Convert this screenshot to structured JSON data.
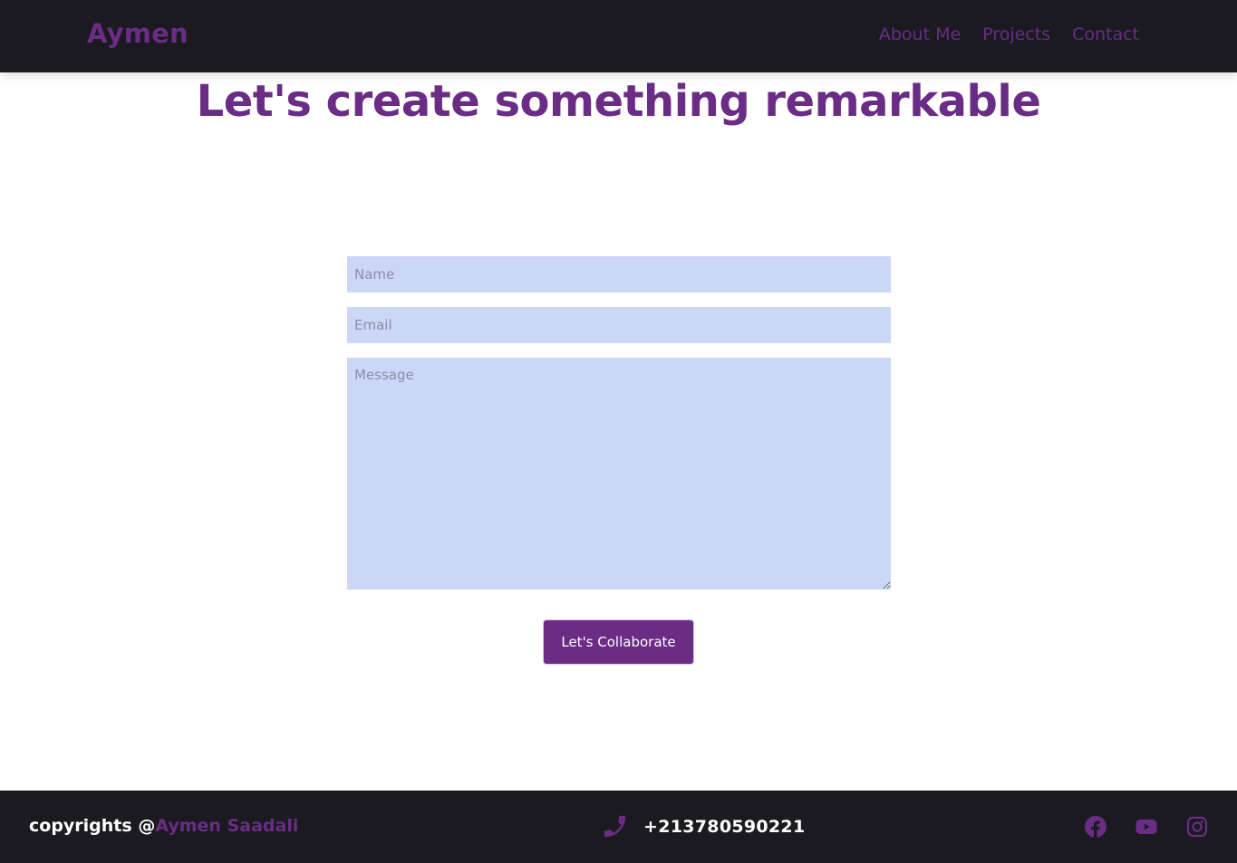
{
  "header": {
    "logo": "Aymen",
    "nav": [
      {
        "label": "About Me"
      },
      {
        "label": "Projects"
      },
      {
        "label": "Contact"
      }
    ]
  },
  "hero": {
    "title": "Let's create something remarkable"
  },
  "form": {
    "name_placeholder": "Name",
    "email_placeholder": "Email",
    "message_placeholder": "Message",
    "submit_label": "Let's Collaborate"
  },
  "footer": {
    "copyright_prefix": "copyrights @",
    "copyright_name": "Aymen Saadali",
    "phone": "+213780590221",
    "socials": [
      {
        "icon": "facebook-icon"
      },
      {
        "icon": "youtube-icon"
      },
      {
        "icon": "instagram-icon"
      }
    ]
  },
  "colors": {
    "brand": "#6a2c85",
    "dark": "#1a1a20",
    "input_bg": "#ccd6f6",
    "background": "#ffffff"
  }
}
